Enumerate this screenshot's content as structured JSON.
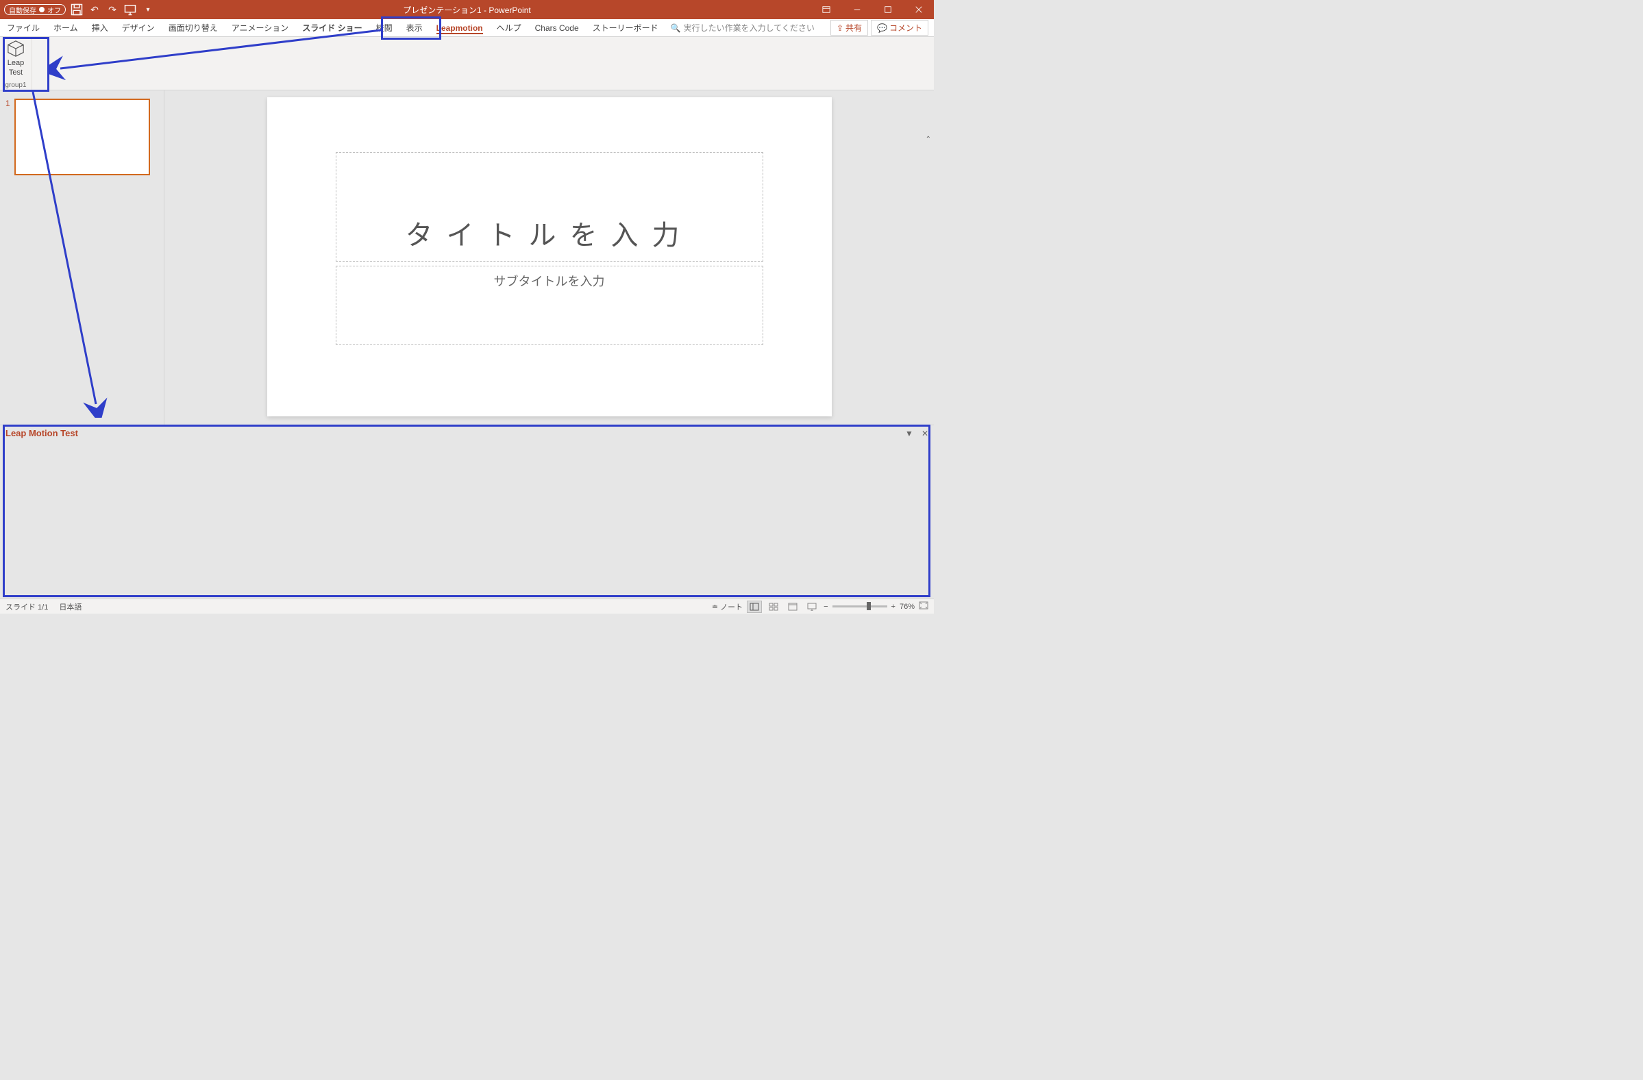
{
  "titlebar": {
    "autosave_label": "自動保存",
    "autosave_state": "オフ",
    "doc_title": "プレゼンテーション1 - PowerPoint"
  },
  "ribbon": {
    "tabs": {
      "file": "ファイル",
      "home": "ホーム",
      "insert": "挿入",
      "design": "デザイン",
      "transitions": "画面切り替え",
      "animations": "アニメーション",
      "slideshow": "スライド ショー",
      "review": "校閲",
      "view": "表示",
      "leapmotion": "Leapmotion",
      "help": "ヘルプ",
      "charscode": "Chars Code",
      "storyboard": "ストーリーボード"
    },
    "tellme_placeholder": "実行したい作業を入力してください",
    "share": "共有",
    "comment": "コメント",
    "leap_btn_l1": "Leap",
    "leap_btn_l2": "Test",
    "group1": "group1"
  },
  "slide": {
    "number": "1",
    "title_placeholder": "タイトルを入力",
    "subtitle_placeholder": "サブタイトルを入力"
  },
  "taskpane": {
    "title": "Leap Motion Test"
  },
  "statusbar": {
    "slide_info": "スライド 1/1",
    "language": "日本語",
    "notes": "ノート",
    "zoom": "76%"
  }
}
